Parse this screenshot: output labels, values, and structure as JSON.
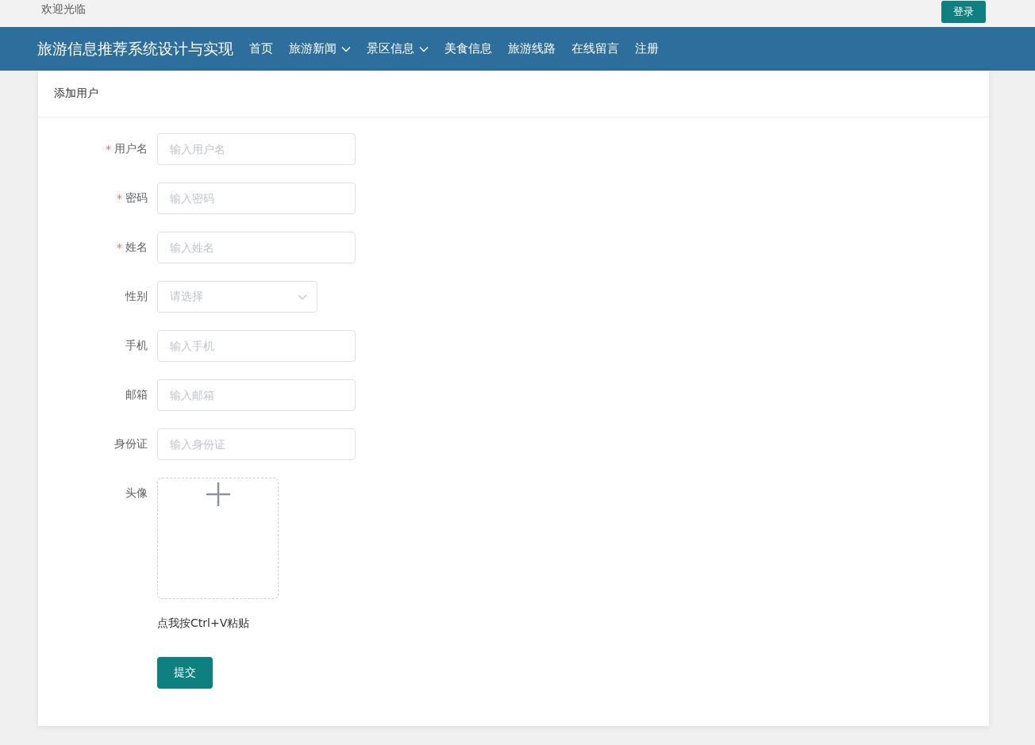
{
  "topbar": {
    "welcome": "欢迎光临",
    "login_button": "登录"
  },
  "nav": {
    "brand": "旅游信息推荐系统设计与实现",
    "items": [
      {
        "label": "首页",
        "dropdown": false
      },
      {
        "label": "旅游新闻",
        "dropdown": true
      },
      {
        "label": "景区信息",
        "dropdown": true
      },
      {
        "label": "美食信息",
        "dropdown": false
      },
      {
        "label": "旅游线路",
        "dropdown": false
      },
      {
        "label": "在线留言",
        "dropdown": false
      },
      {
        "label": "注册",
        "dropdown": false
      }
    ]
  },
  "card": {
    "title": "添加用户"
  },
  "form": {
    "fields": [
      {
        "kind": "input",
        "label": "用户名",
        "required_mark": "*",
        "placeholder": "输入用户名"
      },
      {
        "kind": "input",
        "label": "密码",
        "required_mark": "*",
        "placeholder": "输入密码"
      },
      {
        "kind": "input",
        "label": "姓名",
        "required_mark": "*",
        "placeholder": "输入姓名"
      },
      {
        "kind": "select",
        "label": "性别",
        "placeholder": "请选择"
      },
      {
        "kind": "input",
        "label": "手机",
        "placeholder": "输入手机"
      },
      {
        "kind": "input",
        "label": "邮箱",
        "placeholder": "输入邮箱"
      },
      {
        "kind": "input",
        "label": "身份证",
        "placeholder": "输入身份证"
      },
      {
        "kind": "upload",
        "label": "头像"
      }
    ],
    "paste_hint": "点我按Ctrl+V粘贴",
    "submit": "提交"
  }
}
